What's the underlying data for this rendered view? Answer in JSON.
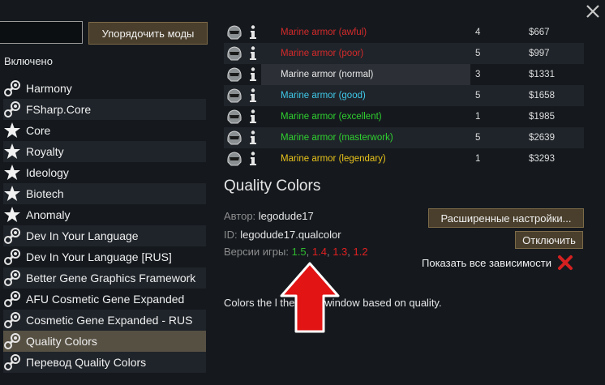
{
  "toolbar": {
    "sort_label": "Упорядочить моды",
    "search_value": ""
  },
  "list": {
    "header": "Включено",
    "mods": [
      {
        "name": "Harmony",
        "icon": "steam-icon"
      },
      {
        "name": "FSharp.Core",
        "icon": "steam-icon"
      },
      {
        "name": "Core",
        "icon": "star-icon"
      },
      {
        "name": "Royalty",
        "icon": "star-icon"
      },
      {
        "name": "Ideology",
        "icon": "star-icon"
      },
      {
        "name": "Biotech",
        "icon": "star-icon"
      },
      {
        "name": "Anomaly",
        "icon": "star-icon"
      },
      {
        "name": "Dev In Your Language",
        "icon": "steam-icon"
      },
      {
        "name": "Dev In Your Language [RUS]",
        "icon": "steam-icon"
      },
      {
        "name": "Better Gene Graphics Framework",
        "icon": "steam-icon"
      },
      {
        "name": "AFU Cosmetic Gene Expanded",
        "icon": "steam-icon"
      },
      {
        "name": "Cosmetic Gene Expanded - RUS",
        "icon": "steam-icon"
      },
      {
        "name": "Quality Colors",
        "icon": "steam-icon",
        "selected": true
      },
      {
        "name": "Перевод Quality Colors",
        "icon": "steam-icon"
      }
    ]
  },
  "trade": {
    "rows": [
      {
        "name": "Marine armor (awful)",
        "qty": "4",
        "price": "$667",
        "color": "#d42a2a"
      },
      {
        "name": "Marine armor (poor)",
        "qty": "5",
        "price": "$997",
        "color": "#d42a2a"
      },
      {
        "name": "Marine armor (normal)",
        "qty": "3",
        "price": "$1331",
        "color": "#e8e8e8"
      },
      {
        "name": "Marine armor (good)",
        "qty": "5",
        "price": "$1658",
        "color": "#3fc8e8"
      },
      {
        "name": "Marine armor (excellent)",
        "qty": "1",
        "price": "$1985",
        "color": "#2fd12f"
      },
      {
        "name": "Marine armor (masterwork)",
        "qty": "5",
        "price": "$2639",
        "color": "#2fd12f"
      },
      {
        "name": "Marine armor (legendary)",
        "qty": "1",
        "price": "$3293",
        "color": "#e8c21a"
      }
    ]
  },
  "detail": {
    "title": "Quality Colors",
    "author_label": "Автор:",
    "author": "legodude17",
    "id_label": "ID:",
    "id": "legodude17.qualcolor",
    "versions_label": "Версии игры:",
    "versions": [
      {
        "v": "1.5",
        "color": "#2fb82f"
      },
      {
        "v": "1.4",
        "color": "#e02020"
      },
      {
        "v": "1.3",
        "color": "#e02020"
      },
      {
        "v": "1.2",
        "color": "#e02020"
      }
    ],
    "advanced_label": "Расширенные настройки...",
    "disable_label": "Отключить",
    "deps_label": "Показать все зависимости",
    "description": "Colors the l       the trade window based on quality."
  }
}
